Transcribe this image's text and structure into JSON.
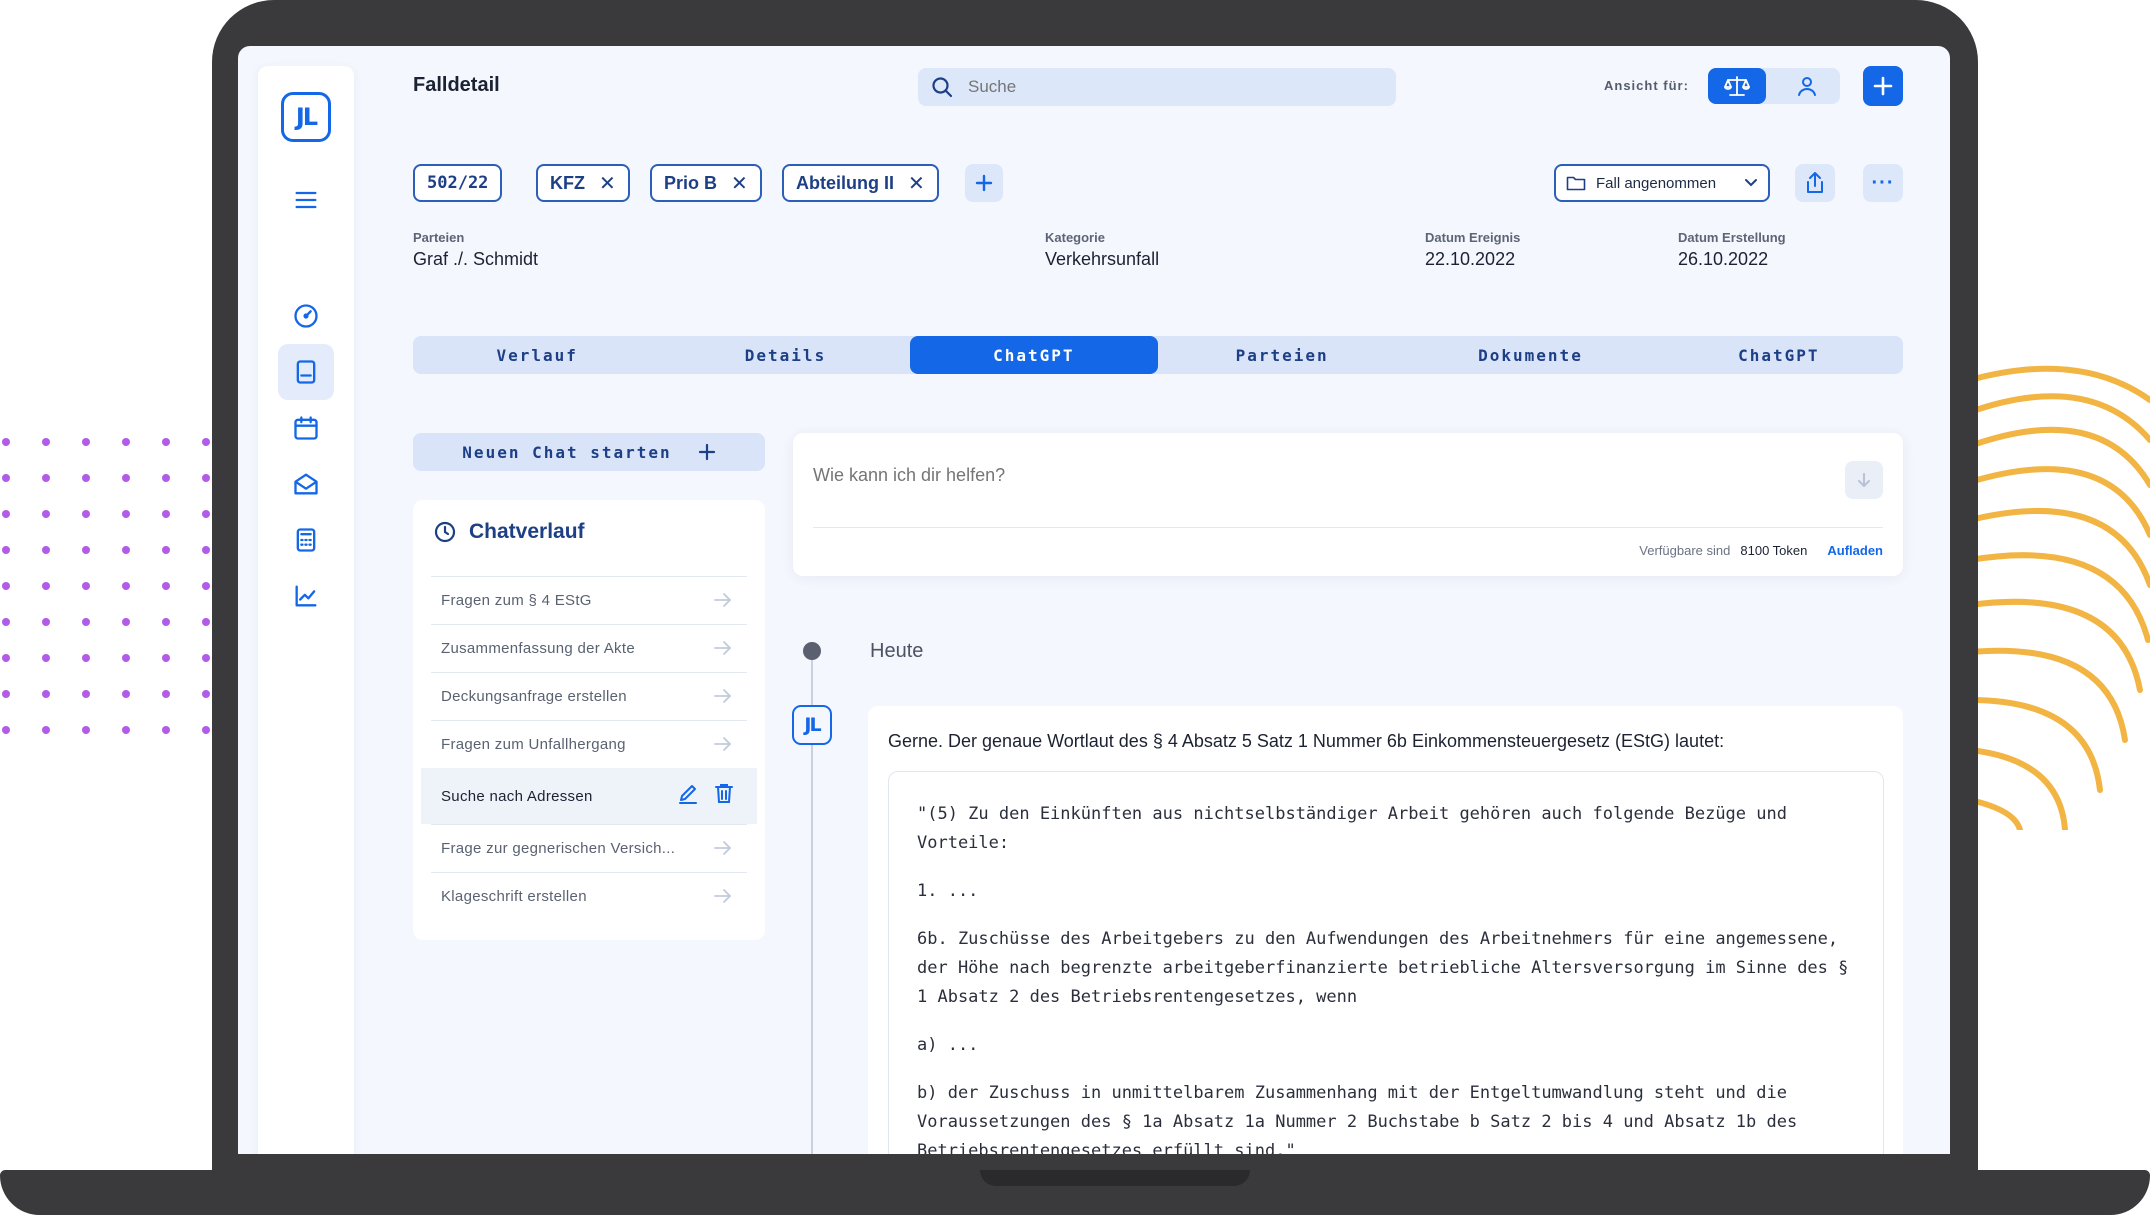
{
  "header": {
    "page_title": "Falldetail",
    "search_placeholder": "Suche",
    "view_label": "Ansicht für:",
    "view_options": [
      "scales-icon",
      "person-icon"
    ],
    "add_icon": "plus-icon"
  },
  "tags": [
    {
      "label": "502/22",
      "removable": false
    },
    {
      "label": "KFZ",
      "removable": true
    },
    {
      "label": "Prio B",
      "removable": true
    },
    {
      "label": "Abteilung II",
      "removable": true
    }
  ],
  "tag_remove_glyph": "✕",
  "status_dropdown": {
    "value": "Fall angenommen",
    "icon": "folder-icon"
  },
  "meta": {
    "parteien": {
      "label": "Parteien",
      "value": "Graf ./. Schmidt"
    },
    "kategorie": {
      "label": "Kategorie",
      "value": "Verkehrsunfall"
    },
    "datum_ereignis": {
      "label": "Datum Ereignis",
      "value": "22.10.2022"
    },
    "datum_erstellung": {
      "label": "Datum Erstellung",
      "value": "26.10.2022"
    }
  },
  "tabs": [
    {
      "label": "Verlauf",
      "active": false
    },
    {
      "label": "Details",
      "active": false
    },
    {
      "label": "ChatGPT",
      "active": true
    },
    {
      "label": "Parteien",
      "active": false
    },
    {
      "label": "Dokumente",
      "active": false
    },
    {
      "label": "ChatGPT",
      "active": false
    }
  ],
  "chat": {
    "new_chat_label": "Neuen Chat starten",
    "history_title": "Chatverlauf",
    "history": [
      {
        "label": "Fragen zum § 4 EStG",
        "active": false
      },
      {
        "label": "Zusammenfassung der Akte",
        "active": false
      },
      {
        "label": "Deckungsanfrage erstellen",
        "active": false
      },
      {
        "label": "Fragen zum Unfallhergang",
        "active": false
      },
      {
        "label": "Suche nach Adressen",
        "active": true
      },
      {
        "label": "Frage zur gegnerischen Versich...",
        "active": false
      },
      {
        "label": "Klageschrift erstellen",
        "active": false
      }
    ],
    "prompt_placeholder": "Wie kann ich dir helfen?",
    "tokens_label": "Verfügbare sind",
    "tokens_value": "8100 Token",
    "reload_label": "Aufladen",
    "timeline_label": "Heute",
    "answer_intro": "Gerne. Der genaue Wortlaut des § 4 Absatz 5 Satz 1 Nummer 6b Einkommensteuergesetz (EStG) lautet:",
    "quote_paragraphs": [
      "\"(5) Zu den Einkünften aus nichtselbständiger Arbeit gehören auch folgende Bezüge und Vorteile:",
      "1. ...",
      "6b. Zuschüsse des Arbeitgebers zu den Aufwendungen des Arbeitnehmers für eine angemessene, der Höhe nach begrenzte arbeitgeberfinanzierte betriebliche Altersversorgung im Sinne des § 1 Absatz 2 des Betriebsrentengesetzes, wenn",
      "a) ...",
      "b) der Zuschuss in unmittelbarem Zusammenhang mit der Entgeltumwandlung steht und die Voraussetzungen des § 1a Absatz 1a Nummer 2 Buchstabe b Satz 2 bis 4 und Absatz 1b des Betriebsrentengesetzes erfüllt sind.\""
    ]
  },
  "brand": {
    "logo_text": "JL",
    "accent": "#1467e6",
    "dark_accent": "#1d3f86",
    "decor_dots": "#b25be8",
    "decor_arcs": "#f2b544"
  },
  "sidebar_icons": [
    "menu-icon",
    "dashboard-icon",
    "cases-icon",
    "calendar-icon",
    "mail-icon",
    "calculator-icon",
    "chart-icon"
  ]
}
